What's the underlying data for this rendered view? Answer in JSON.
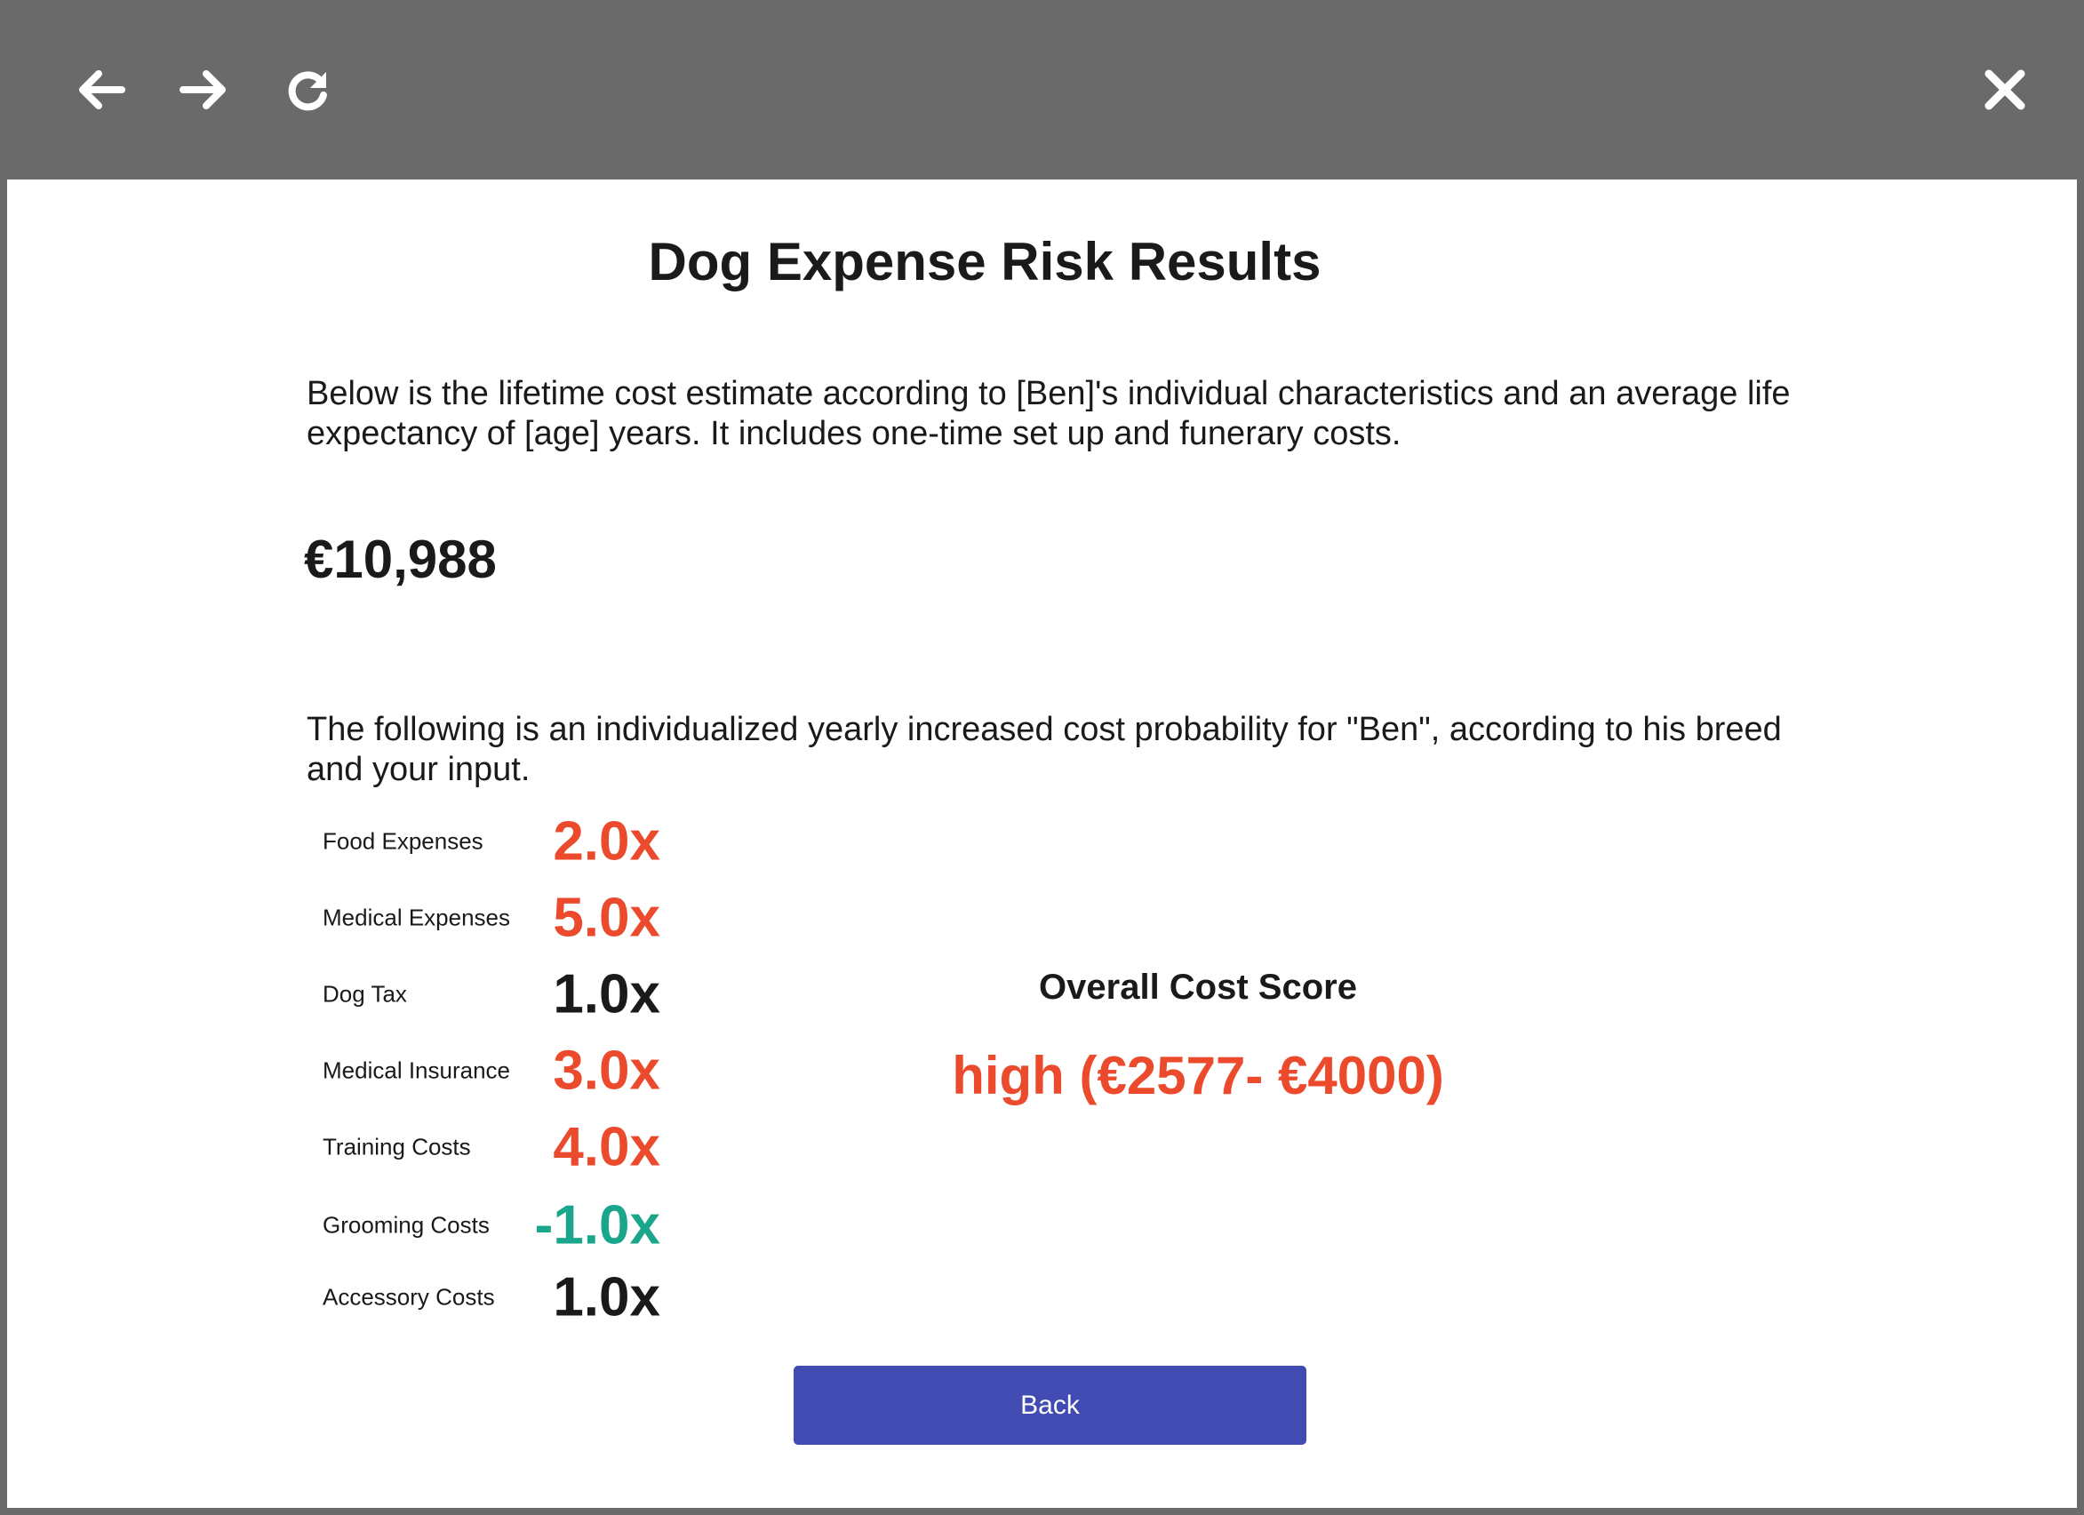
{
  "colors": {
    "toolbar_bg": "#6a6a6a",
    "increase": "#ec4a2c",
    "decrease": "#19a68a",
    "neutral": "#1a1a1a",
    "button_bg": "#414bb2",
    "button_text": "#ffffff"
  },
  "toolbar": {
    "back_icon": "arrow-left-icon",
    "forward_icon": "arrow-right-icon",
    "reload_icon": "reload-icon",
    "close_icon": "close-icon"
  },
  "page": {
    "title": "Dog Expense Risk Results",
    "intro": "Below is the lifetime cost estimate according to [Ben]'s individual characteristics and an average life expectancy of [age] years. It includes one-time set up and funerary costs.",
    "total_cost": "€10,988",
    "individual_text": "The following is an individualized yearly increased cost probability for \"Ben\", according to his breed and your input."
  },
  "factors": [
    {
      "label": "Food Expenses",
      "value": "2.0x",
      "trend": "increase"
    },
    {
      "label": "Medical Expenses",
      "value": "5.0x",
      "trend": "increase"
    },
    {
      "label": "Dog Tax",
      "value": "1.0x",
      "trend": "neutral"
    },
    {
      "label": "Medical Insurance",
      "value": "3.0x",
      "trend": "increase"
    },
    {
      "label": "Training Costs",
      "value": "4.0x",
      "trend": "increase"
    },
    {
      "label": "Grooming Costs",
      "value": "-1.0x",
      "trend": "decrease"
    },
    {
      "label": "Accessory Costs",
      "value": "1.0x",
      "trend": "neutral"
    }
  ],
  "score": {
    "title": "Overall Cost Score",
    "value": "high (€2577- €4000)"
  },
  "back_button": {
    "label": "Back"
  }
}
